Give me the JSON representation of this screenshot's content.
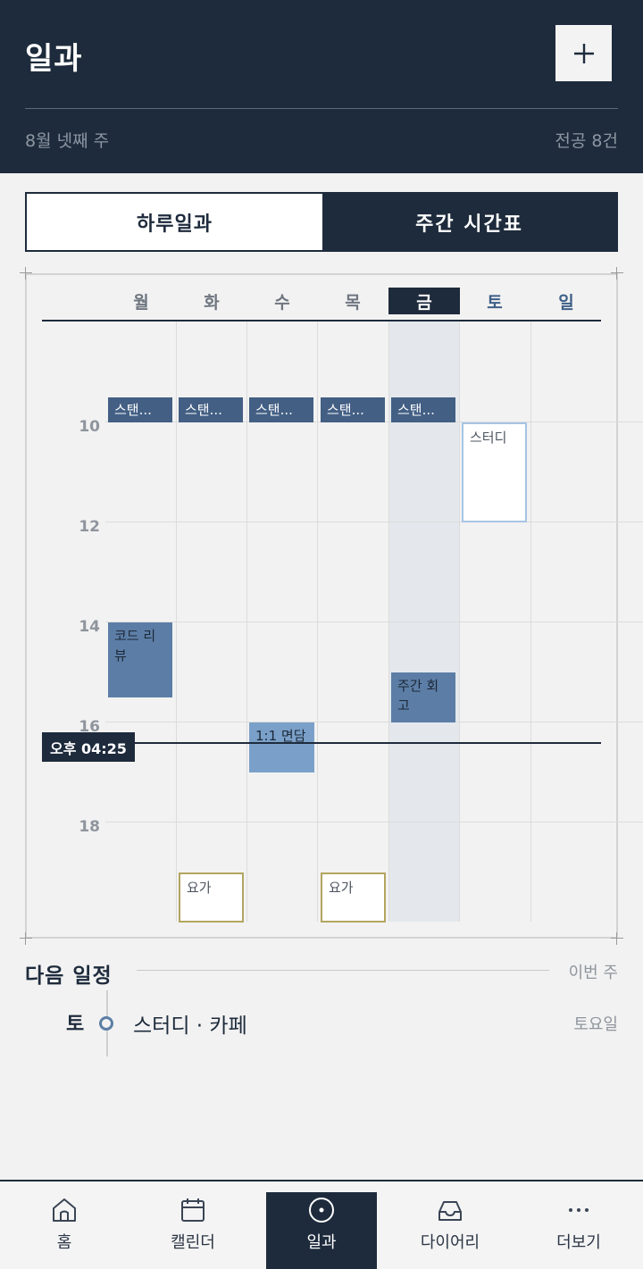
{
  "header": {
    "title": "일과",
    "add_icon": "plus-icon",
    "week": "8월 넷째 주",
    "major_count": "전공 8건"
  },
  "view_toggle": {
    "day": "하루일과",
    "week": "주간 시간표",
    "active": "week"
  },
  "timetable": {
    "days": [
      "월",
      "화",
      "수",
      "목",
      "금",
      "토",
      "일"
    ],
    "today": "금",
    "hour_labels": [
      "10",
      "12",
      "14",
      "16",
      "18"
    ],
    "now_label": "오후 04:25",
    "events": [
      {
        "day": "월",
        "title": "스탠..."
      },
      {
        "day": "화",
        "title": "스탠..."
      },
      {
        "day": "수",
        "title": "스탠..."
      },
      {
        "day": "목",
        "title": "스탠..."
      },
      {
        "day": "금",
        "title": "스탠..."
      },
      {
        "day": "토",
        "title": "스터디"
      },
      {
        "day": "월",
        "title": "코드 리뷰"
      },
      {
        "day": "금",
        "title": "주간 회고"
      },
      {
        "day": "수",
        "title": "1:1 면담"
      },
      {
        "day": "화",
        "title": "요가"
      },
      {
        "day": "목",
        "title": "요가"
      }
    ],
    "colors": {
      "navy": "#1e2b3c",
      "standup": "#435f84",
      "review": "#5c7ea6",
      "meeting": "#7aa0c9",
      "study_border": "#a6c4e4",
      "yoga_border": "#b3a560"
    }
  },
  "next_schedule": {
    "title": "다음 일정",
    "scope": "이번 주",
    "items": [
      {
        "day": "토",
        "title": "스터디 · 카페",
        "when": "토요일"
      }
    ]
  },
  "bottom_nav": {
    "items": [
      {
        "label": "홈",
        "icon": "home-icon"
      },
      {
        "label": "캘린더",
        "icon": "calendar-icon"
      },
      {
        "label": "일과",
        "icon": "compass-icon"
      },
      {
        "label": "다이어리",
        "icon": "inbox-icon"
      },
      {
        "label": "더보기",
        "icon": "more-icon"
      }
    ],
    "active": "일과"
  }
}
